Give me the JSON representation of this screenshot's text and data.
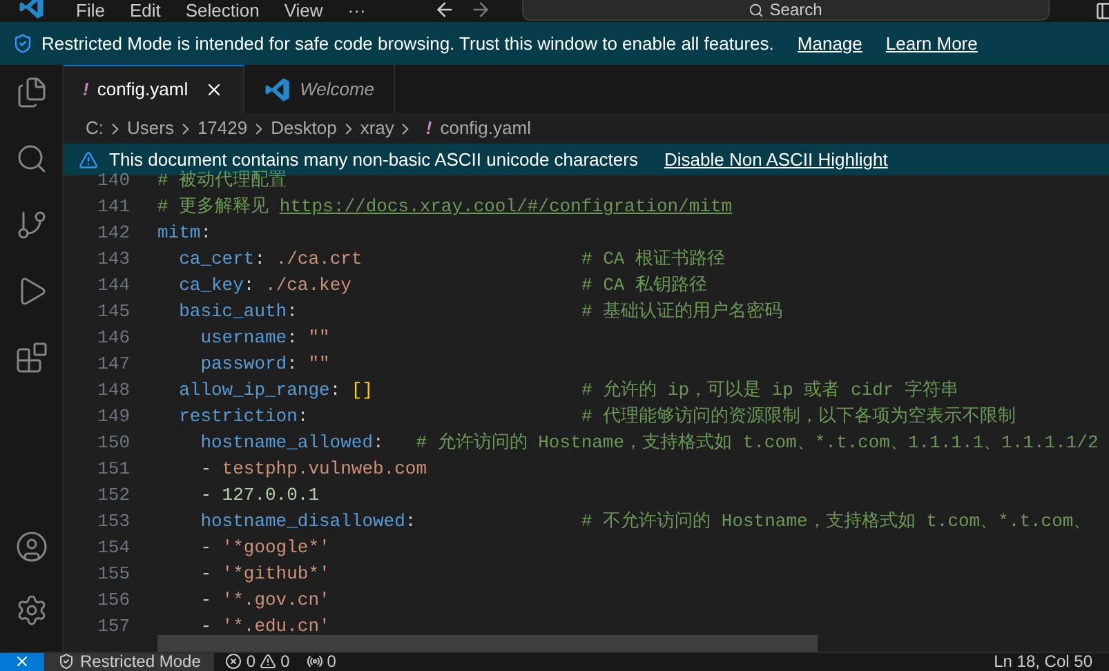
{
  "menu_bar": {
    "items": [
      "File",
      "Edit",
      "Selection",
      "View",
      "···"
    ],
    "search": {
      "placeholder": "Search"
    }
  },
  "restricted_banner": {
    "message": "Restricted Mode is intended for safe code browsing. Trust this window to enable all features.",
    "links": [
      "Manage",
      "Learn More"
    ]
  },
  "activity_bar": {
    "items": [
      {
        "kind": "files"
      },
      {
        "kind": "search"
      },
      {
        "kind": "source-control"
      },
      {
        "kind": "run"
      },
      {
        "kind": "extensions"
      }
    ],
    "bottom_items": [
      {
        "kind": "account"
      },
      {
        "kind": "settings"
      }
    ]
  },
  "tabs": [
    {
      "label": "config.yaml",
      "icon": "!",
      "selected": true,
      "italic": false
    },
    {
      "label": "Welcome",
      "selected": false,
      "italic": true
    }
  ],
  "breadcrumb": {
    "parts": [
      "C:",
      "Users",
      "17429",
      "Desktop",
      "xray"
    ],
    "file": {
      "icon": "!",
      "label": "config.yaml"
    }
  },
  "ascii_warning": {
    "message": "This document contains many non-basic ASCII unicode characters",
    "action": "Disable Non ASCII Highlight"
  },
  "code_lines": [
    {
      "number": "140",
      "tokens": [
        {
          "kind": "comment",
          "text": "# 被动代理配置"
        }
      ]
    },
    {
      "number": "141",
      "tokens": [
        {
          "kind": "comment",
          "text": "# 更多解释见"
        },
        {
          "kind": "link",
          "text": "https://docs.xray.cool/#/configration/mitm"
        }
      ]
    },
    {
      "number": "142",
      "tokens": [
        {
          "kind": "key",
          "text": "mitm"
        },
        {
          "kind": "colon",
          "text": ":"
        }
      ],
      "children": [
        {
          "number": "143",
          "tokens": [
            {
              "kind": "key",
              "text": "ca_cert"
            },
            {
              "kind": "colon",
              "text": ":"
            },
            {
              "kind": "string",
              "text": "./ca.crt"
            }
          ],
          "comment": {
            "text": "# CA 根证书路径",
            "aligned": true
          }
        },
        {
          "number": "144",
          "tokens": [
            {
              "kind": "key",
              "text": "ca_key"
            },
            {
              "kind": "colon",
              "text": ":"
            },
            {
              "kind": "string",
              "text": "./ca.key"
            }
          ],
          "comment": {
            "text": "# CA 私钥路径",
            "aligned": true
          }
        },
        {
          "number": "145",
          "tokens": [
            {
              "kind": "key",
              "text": "basic_auth"
            },
            {
              "kind": "colon",
              "text": ":"
            }
          ],
          "comment": {
            "text": "# 基础认证的用户名密码",
            "aligned": true
          },
          "children": [
            {
              "number": "146",
              "tokens": [
                {
                  "kind": "key",
                  "text": "username"
                },
                {
                  "kind": "colon",
                  "text": ":"
                },
                {
                  "kind": "string",
                  "text": "\"\""
                }
              ]
            },
            {
              "number": "147",
              "tokens": [
                {
                  "kind": "key",
                  "text": "password"
                },
                {
                  "kind": "colon",
                  "text": ":"
                },
                {
                  "kind": "string",
                  "text": "\"\""
                }
              ]
            }
          ]
        },
        {
          "number": "148",
          "tokens": [
            {
              "kind": "key",
              "text": "allow_ip_range"
            },
            {
              "kind": "colon",
              "text": ":"
            },
            {
              "kind": "bracket",
              "text": "[]"
            }
          ],
          "comment": {
            "text": "# 允许的 ip，可以是 ip 或者 cidr 字符串",
            "aligned": true
          }
        },
        {
          "number": "149",
          "tokens": [
            {
              "kind": "key",
              "text": "restriction"
            },
            {
              "kind": "colon",
              "text": ":"
            }
          ],
          "comment": {
            "text": "# 代理能够访问的资源限制，以下各项为空表示不限制",
            "aligned": true
          },
          "children": [
            {
              "number": "150",
              "tokens": [
                {
                  "kind": "key",
                  "text": "hostname_allowed"
                },
                {
                  "kind": "colon",
                  "text": ":"
                }
              ],
              "comment": {
                "text": "# 允许访问的 Hostname，支持格式如 t.com、*.t.com、1.1.1.1、1.1.1.1/2",
                "aligned": false
              },
              "children": [
                {
                  "number": "151",
                  "tokens": [
                    {
                      "kind": "dash",
                      "text": "-"
                    },
                    {
                      "kind": "string",
                      "text": "testphp.vulnweb.com"
                    }
                  ]
                },
                {
                  "number": "152",
                  "tokens": [
                    {
                      "kind": "dash",
                      "text": "-"
                    },
                    {
                      "kind": "number",
                      "text": "127.0.0.1"
                    }
                  ]
                }
              ]
            },
            {
              "number": "153",
              "tokens": [
                {
                  "kind": "key",
                  "text": "hostname_disallowed"
                },
                {
                  "kind": "colon",
                  "text": ":"
                }
              ],
              "comment": {
                "text": "# 不允许访问的 Hostname，支持格式如 t.com、*.t.com、",
                "aligned": true
              },
              "children": [
                {
                  "number": "154",
                  "tokens": [
                    {
                      "kind": "dash",
                      "text": "-"
                    },
                    {
                      "kind": "string",
                      "text": "'*google*'"
                    }
                  ]
                },
                {
                  "number": "155",
                  "tokens": [
                    {
                      "kind": "dash",
                      "text": "-"
                    },
                    {
                      "kind": "string",
                      "text": "'*github*'"
                    }
                  ]
                },
                {
                  "number": "156",
                  "tokens": [
                    {
                      "kind": "dash",
                      "text": "-"
                    },
                    {
                      "kind": "string",
                      "text": "'*.gov.cn'"
                    }
                  ]
                },
                {
                  "number": "157",
                  "tokens": [
                    {
                      "kind": "dash",
                      "text": "-"
                    },
                    {
                      "kind": "string",
                      "text": "'*.edu.cn'"
                    }
                  ]
                }
              ]
            }
          ]
        }
      ]
    }
  ],
  "status_bar": {
    "mode": "Restricted Mode",
    "errors": "0",
    "warnings": "0",
    "ports": "0",
    "position": "Ln 18, Col 50"
  }
}
